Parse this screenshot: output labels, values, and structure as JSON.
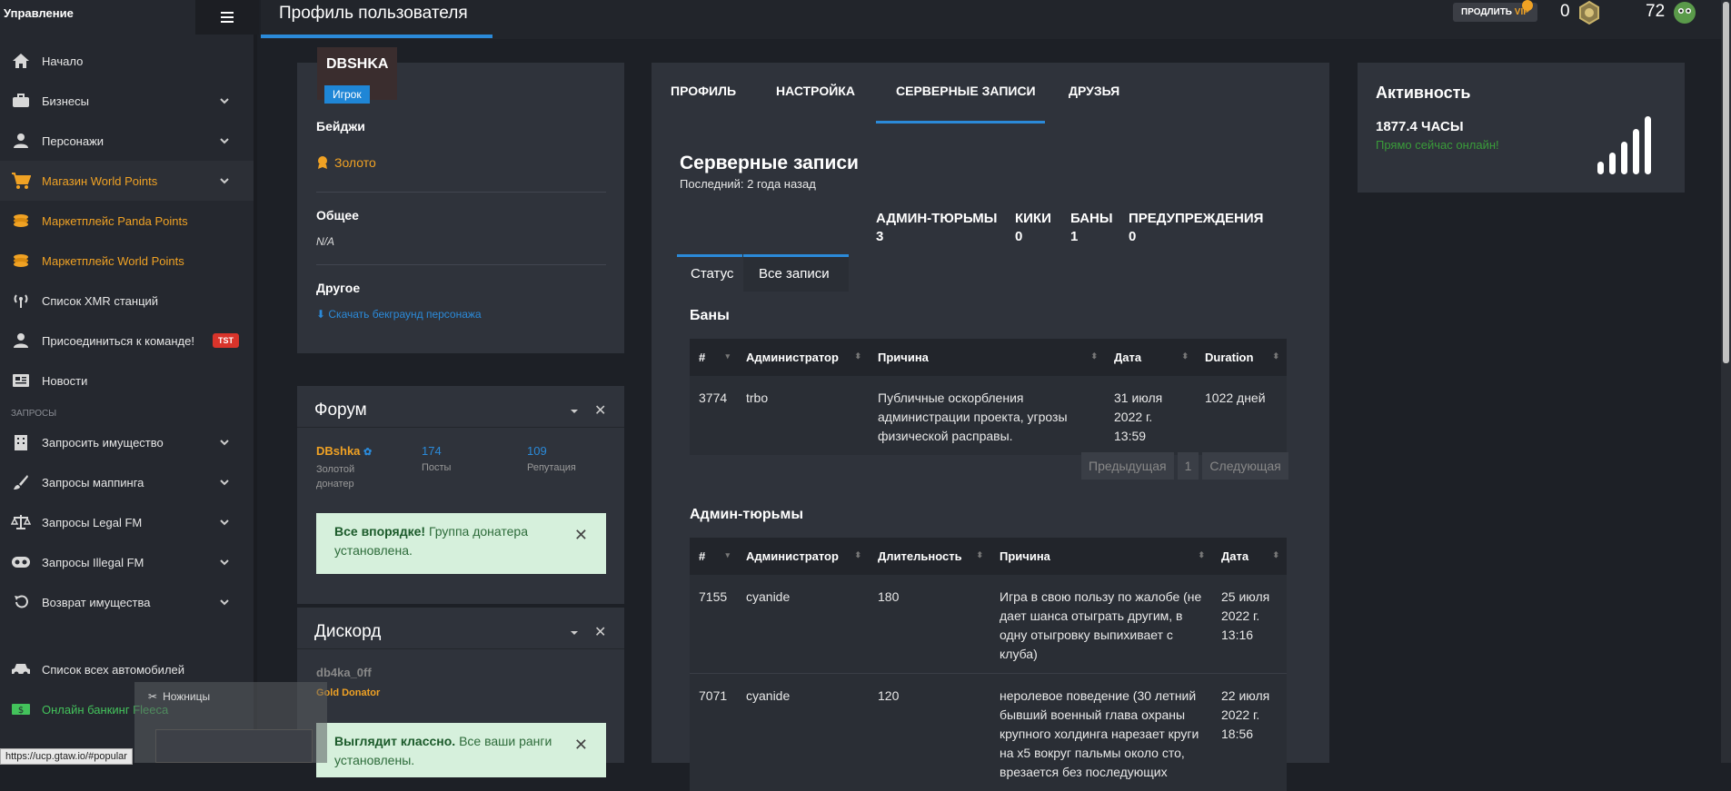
{
  "sidebar": {
    "title": "Управление",
    "menu_icon": "hamburger-icon",
    "items": [
      {
        "label": "Начало",
        "icon": "home-icon"
      },
      {
        "label": "Бизнесы",
        "icon": "briefcase-icon"
      },
      {
        "label": "Персонажи",
        "icon": "user-icon"
      },
      {
        "label": "Магазин World Points",
        "icon": "cart-icon"
      },
      {
        "label": "Маркетплейс Panda Points",
        "icon": "coins-icon"
      },
      {
        "label": "Маркетплейс World Points",
        "icon": "coins-icon"
      },
      {
        "label": "Список XMR станций",
        "icon": "antenna-icon"
      },
      {
        "label": "Присоединиться к команде!",
        "icon": "user-plus-icon",
        "badge": "TST"
      },
      {
        "label": "Новости",
        "icon": "newspaper-icon"
      }
    ],
    "section_label": "ЗАПРОСЫ",
    "request_items": [
      {
        "label": "Запросить имущество",
        "icon": "building-icon"
      },
      {
        "label": "Запросы маппинга",
        "icon": "brush-icon"
      },
      {
        "label": "Запросы Legal FM",
        "icon": "scale-icon"
      },
      {
        "label": "Запросы Illegal FM",
        "icon": "mask-icon"
      },
      {
        "label": "Возврат имущества",
        "icon": "undo-icon"
      }
    ],
    "bottom_items": [
      {
        "label": "Список всех автомобилей",
        "icon": "car-icon"
      },
      {
        "label": "Онлайн банкинг Fleeca",
        "icon": "money-icon"
      }
    ]
  },
  "topbar": {
    "page_title": "Профиль пользователя",
    "vip_label": "ПРОДЛИТЬ",
    "vip_accent": "VIP",
    "counter1": "0",
    "counter2": "72"
  },
  "profile": {
    "username": "DBSHKA",
    "role": "Игрок",
    "badges_label": "Бейджи",
    "badge": "Золото",
    "general_label": "Общее",
    "general_value": "N/A",
    "other_label": "Другое",
    "download_link": "Скачать бекграунд персонажа"
  },
  "forum": {
    "title": "Форум",
    "name": "DBshka",
    "rank": "Золотой донатер",
    "posts": "174",
    "posts_label": "Посты",
    "rep": "109",
    "rep_label": "Репутация",
    "alert_bold": "Все впорядке!",
    "alert_text": "Группа донатера установлена."
  },
  "discord": {
    "title": "Дискорд",
    "name": "db4ka_0ff",
    "role": "Gold Donator",
    "alert_bold": "Выглядит классно.",
    "alert_text": "Все ваши ранги установлены."
  },
  "tabs": [
    "ПРОФИЛЬ",
    "НАСТРОЙКА",
    "СЕРВЕРНЫЕ ЗАПИСИ",
    "ДРУЗЬЯ"
  ],
  "records": {
    "title": "Серверные записи",
    "last": "Последний: 2 года назад",
    "stats": [
      {
        "label": "АДМИН-ТЮРЬМЫ",
        "value": "3"
      },
      {
        "label": "КИКИ",
        "value": "0"
      },
      {
        "label": "БАНЫ",
        "value": "1"
      },
      {
        "label": "ПРЕДУПРЕЖДЕНИЯ",
        "value": "0"
      }
    ],
    "subtabs": [
      "Статус",
      "Все записи"
    ]
  },
  "bans": {
    "title": "Баны",
    "headers": [
      "#",
      "Администратор",
      "Причина",
      "Дата",
      "Duration"
    ],
    "rows": [
      {
        "id": "3774",
        "admin": "trbo",
        "reason": "Публичные оскорбления администрации проекта, угрозы физической расправы.",
        "date": "31 июля 2022 г. 13:59",
        "duration": "1022 дней"
      }
    ],
    "pager": [
      "Предыдущая",
      "1",
      "Следующая"
    ]
  },
  "jails": {
    "title": "Админ-тюрьмы",
    "headers": [
      "#",
      "Администратор",
      "Длительность",
      "Причина",
      "Дата"
    ],
    "rows": [
      {
        "id": "7155",
        "admin": "cyanide",
        "duration": "180",
        "reason": "Игра в свою пользу по жалобе (не дает шанса отыграть другим, в одну отыгровку выпихивает с клуба)",
        "date": "25 июля 2022 г. 13:16"
      },
      {
        "id": "7071",
        "admin": "cyanide",
        "duration": "120",
        "reason": "неролевое поведение (30 летний бывший военный глава охраны крупного холдинга нарезает круги на x5 вокруг пальмы около сто, врезается без последующих",
        "date": "22 июля 2022 г. 18:56"
      }
    ]
  },
  "activity": {
    "title": "Активность",
    "hours": "1877.4 ЧАСЫ",
    "status": "Прямо сейчас онлайн!",
    "signal_icon": "signal-bars-icon"
  },
  "overlay": {
    "snip_label": "Ножницы",
    "url": "https://ucp.gtaw.io/#popular"
  }
}
